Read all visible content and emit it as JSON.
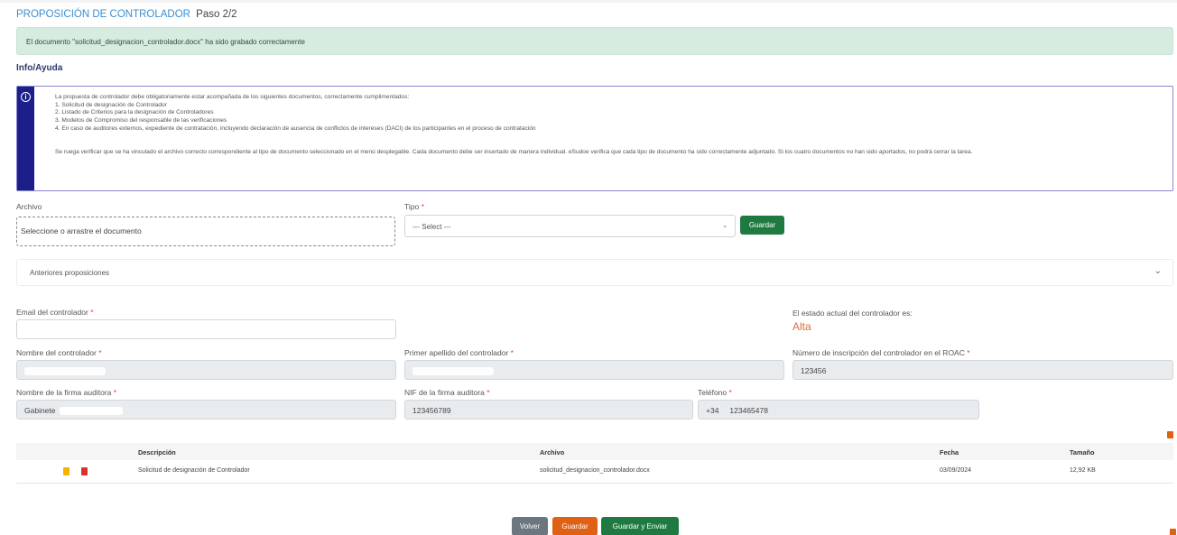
{
  "header": {
    "title": "PROPOSICIÓN DE CONTROLADOR",
    "step": "Paso 2/2"
  },
  "alert": {
    "message": "El documento \"solicitud_designacion_controlador.docx\" ha sido grabado correctamente"
  },
  "help": {
    "title": "Info/Ayuda",
    "intro": "La propuesta de controlador debe obligatoriamente estar acompañada de los siguientes documentos, correctamente cumplimentados:",
    "items": [
      "1. Solicitud de designación de Controlador",
      "2. Listado de Criterios para la designación de Controladores",
      "3. Modelos de Compromiso del responsable de las verificaciones",
      "4. En caso de auditores externos, expediente de contratación, incluyendo declaración de ausencia de conflictos de intereses (DACI) de los participantes en el proceso de contratación"
    ],
    "note": "Se ruega verificar que se ha vinculado el archivo correcto correspondiente al tipo de documento seleccionado en el menú desplegable. Cada documento debe ser insertado de manera individual. eSudoe verifica que cada tipo de documento ha sido correctamente adjuntado. Si los cuatro documentos no han sido aportados, no podrá cerrar la tarea."
  },
  "upload": {
    "archivo_label": "Archivo",
    "dropzone_text": "Seleccione o arrastre el documento",
    "tipo_label": "Tipo",
    "tipo_selected": "--- Select ---",
    "save_label": "Guardar"
  },
  "accordion": {
    "label": "Anteriores proposiciones"
  },
  "form": {
    "email_label": "Email del controlador",
    "estado_label": "El estado actual del controlador es:",
    "estado_value": "Alta",
    "nombre_label": "Nombre del controlador",
    "apellido_label": "Primer apellido del controlador",
    "roac_label": "Número de inscripción del controlador en el ROAC",
    "roac_value": "123456",
    "firma_label": "Nombre de la firma auditora",
    "firma_value": "Gabinete",
    "nif_label": "NIF de la firma auditora",
    "nif_value": "123456789",
    "telefono_label": "Teléfono",
    "telefono_prefix": "+34",
    "telefono_value": "123465478",
    "required_mark": "*"
  },
  "table": {
    "columns": [
      "Descripción",
      "Archivo",
      "Fecha",
      "Tamaño"
    ],
    "rows": [
      {
        "descripcion": "Solicitud de designación de Controlador",
        "archivo": "solicitud_designacion_controlador.docx",
        "fecha": "03/09/2024",
        "tamano": "12,92 KB"
      }
    ]
  },
  "footer": {
    "volver_label": "Volver",
    "guardar_label": "Guardar",
    "enviar_label": "Guardar y Enviar"
  },
  "colors": {
    "accent_blue": "#3a8fd0",
    "success_bg": "#d6ece1",
    "info_bar": "#1c1f8a",
    "green": "#1f7a41",
    "orange": "#e06014",
    "gray": "#6b767e",
    "status": "#e06a3c"
  }
}
